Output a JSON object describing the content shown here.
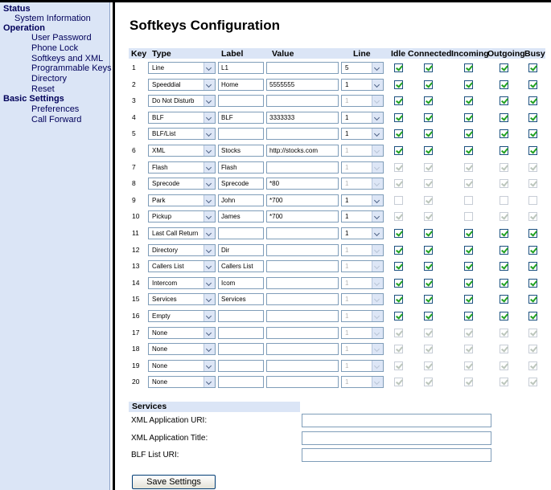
{
  "sidebar": {
    "sections": [
      {
        "title": "Status",
        "items": [
          {
            "label": "System Information"
          }
        ]
      },
      {
        "title": "Operation",
        "items": [
          {
            "label": "User Password"
          },
          {
            "label": "Phone Lock"
          },
          {
            "label": "Softkeys and XML"
          },
          {
            "label": "Programmable Keys"
          },
          {
            "label": "Directory"
          },
          {
            "label": "Reset"
          }
        ]
      },
      {
        "title": "Basic Settings",
        "items": [
          {
            "label": "Preferences"
          },
          {
            "label": "Call Forward"
          }
        ]
      }
    ]
  },
  "page": {
    "title": "Softkeys Configuration"
  },
  "table": {
    "headers": {
      "key": "Key",
      "type": "Type",
      "label": "Label",
      "value": "Value",
      "line": "Line",
      "idle": "Idle",
      "connected": "Connected",
      "incoming": "Incoming",
      "outgoing": "Outgoing",
      "busy": "Busy"
    },
    "rows": [
      {
        "key": "1",
        "type": "Line",
        "label": "L1",
        "value": "",
        "line": "5",
        "line_enabled": true,
        "states": [
          1,
          1,
          1,
          1,
          1
        ],
        "states_enabled": true
      },
      {
        "key": "2",
        "type": "Speeddial",
        "label": "Home",
        "value": "5555555",
        "line": "1",
        "line_enabled": true,
        "states": [
          1,
          1,
          1,
          1,
          1
        ],
        "states_enabled": true
      },
      {
        "key": "3",
        "type": "Do Not Disturb",
        "label": "",
        "value": "",
        "line": "1",
        "line_enabled": false,
        "states": [
          1,
          1,
          1,
          1,
          1
        ],
        "states_enabled": true
      },
      {
        "key": "4",
        "type": "BLF",
        "label": "BLF",
        "value": "3333333",
        "line": "1",
        "line_enabled": true,
        "states": [
          1,
          1,
          1,
          1,
          1
        ],
        "states_enabled": true
      },
      {
        "key": "5",
        "type": "BLF/List",
        "label": "",
        "value": "",
        "line": "1",
        "line_enabled": true,
        "states": [
          1,
          1,
          1,
          1,
          1
        ],
        "states_enabled": true
      },
      {
        "key": "6",
        "type": "XML",
        "label": "Stocks",
        "value": "http://stocks.com",
        "line": "1",
        "line_enabled": false,
        "states": [
          1,
          1,
          1,
          1,
          1
        ],
        "states_enabled": true
      },
      {
        "key": "7",
        "type": "Flash",
        "label": "Flash",
        "value": "",
        "line": "1",
        "line_enabled": false,
        "states": [
          1,
          1,
          1,
          1,
          1
        ],
        "states_enabled": false
      },
      {
        "key": "8",
        "type": "Sprecode",
        "label": "Sprecode",
        "value": "*80",
        "line": "1",
        "line_enabled": false,
        "states": [
          1,
          1,
          1,
          1,
          1
        ],
        "states_enabled": false
      },
      {
        "key": "9",
        "type": "Park",
        "label": "John",
        "value": "*700",
        "line": "1",
        "line_enabled": true,
        "states": [
          0,
          1,
          0,
          0,
          0
        ],
        "states_enabled": false
      },
      {
        "key": "10",
        "type": "Pickup",
        "label": "James",
        "value": "*700",
        "line": "1",
        "line_enabled": true,
        "states": [
          1,
          1,
          0,
          1,
          1
        ],
        "states_enabled": false
      },
      {
        "key": "11",
        "type": "Last Call Return",
        "label": "",
        "value": "",
        "line": "1",
        "line_enabled": true,
        "states": [
          1,
          1,
          1,
          1,
          1
        ],
        "states_enabled": true
      },
      {
        "key": "12",
        "type": "Directory",
        "label": "Dir",
        "value": "",
        "line": "1",
        "line_enabled": false,
        "states": [
          1,
          1,
          1,
          1,
          1
        ],
        "states_enabled": true
      },
      {
        "key": "13",
        "type": "Callers List",
        "label": "Callers List",
        "value": "",
        "line": "1",
        "line_enabled": false,
        "states": [
          1,
          1,
          1,
          1,
          1
        ],
        "states_enabled": true
      },
      {
        "key": "14",
        "type": "Intercom",
        "label": "Icom",
        "value": "",
        "line": "1",
        "line_enabled": false,
        "states": [
          1,
          1,
          1,
          1,
          1
        ],
        "states_enabled": true
      },
      {
        "key": "15",
        "type": "Services",
        "label": "Services",
        "value": "",
        "line": "1",
        "line_enabled": false,
        "states": [
          1,
          1,
          1,
          1,
          1
        ],
        "states_enabled": true
      },
      {
        "key": "16",
        "type": "Empty",
        "label": "",
        "value": "",
        "line": "1",
        "line_enabled": false,
        "states": [
          1,
          1,
          1,
          1,
          1
        ],
        "states_enabled": true
      },
      {
        "key": "17",
        "type": "None",
        "label": "",
        "value": "",
        "line": "1",
        "line_enabled": false,
        "states": [
          1,
          1,
          1,
          1,
          1
        ],
        "states_enabled": false
      },
      {
        "key": "18",
        "type": "None",
        "label": "",
        "value": "",
        "line": "1",
        "line_enabled": false,
        "states": [
          1,
          1,
          1,
          1,
          1
        ],
        "states_enabled": false
      },
      {
        "key": "19",
        "type": "None",
        "label": "",
        "value": "",
        "line": "1",
        "line_enabled": false,
        "states": [
          1,
          1,
          1,
          1,
          1
        ],
        "states_enabled": false
      },
      {
        "key": "20",
        "type": "None",
        "label": "",
        "value": "",
        "line": "1",
        "line_enabled": false,
        "states": [
          1,
          1,
          1,
          1,
          1
        ],
        "states_enabled": false
      }
    ]
  },
  "services": {
    "title": "Services",
    "xml_app_uri_label": "XML Application URI:",
    "xml_app_title_label": "XML Application Title:",
    "blf_list_uri_label": "BLF List URI:"
  },
  "buttons": {
    "save": "Save Settings"
  },
  "colors": {
    "sidebar_bg": "#dbe5f6",
    "header_bg": "#dbe5f6",
    "nav_text": "#00005a",
    "check_green": "#21a121"
  },
  "icons": {
    "dropdown": "chevron-down-icon",
    "checkbox": "checkmark-icon"
  }
}
